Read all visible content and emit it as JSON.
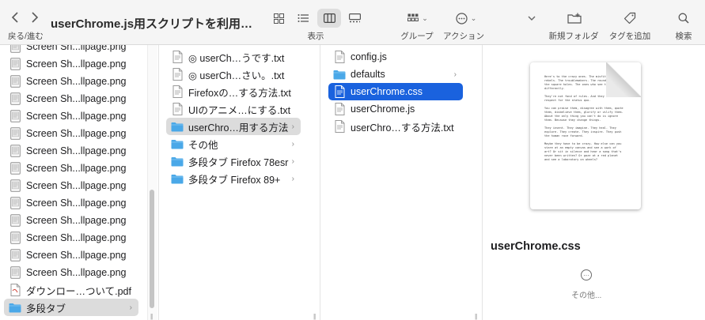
{
  "toolbar": {
    "nav_label": "戻る/進む",
    "title": "userChrome.js用スクリプトを利用…",
    "view_label": "表示",
    "group_label": "グループ",
    "action_label": "アクション",
    "new_folder_label": "新規フォルダ",
    "tag_label": "タグを追加",
    "search_label": "検索"
  },
  "column1": {
    "items": [
      {
        "label": "Screen Sh...llpage.png",
        "icon": "image-file-icon"
      },
      {
        "label": "Screen Sh...llpage.png",
        "icon": "image-file-icon"
      },
      {
        "label": "Screen Sh...llpage.png",
        "icon": "image-file-icon"
      },
      {
        "label": "Screen Sh...llpage.png",
        "icon": "image-file-icon"
      },
      {
        "label": "Screen Sh...llpage.png",
        "icon": "image-file-icon"
      },
      {
        "label": "Screen Sh...llpage.png",
        "icon": "image-file-icon"
      },
      {
        "label": "Screen Sh...llpage.png",
        "icon": "image-file-icon"
      },
      {
        "label": "Screen Sh...llpage.png",
        "icon": "image-file-icon"
      },
      {
        "label": "Screen Sh...llpage.png",
        "icon": "image-file-icon"
      },
      {
        "label": "Screen Sh...llpage.png",
        "icon": "image-file-icon"
      },
      {
        "label": "Screen Sh...llpage.png",
        "icon": "image-file-icon"
      },
      {
        "label": "Screen Sh...llpage.png",
        "icon": "image-file-icon"
      },
      {
        "label": "Screen Sh...llpage.png",
        "icon": "image-file-icon"
      },
      {
        "label": "Screen Sh...llpage.png",
        "icon": "image-file-icon"
      },
      {
        "label": "ダウンロー…ついて.pdf",
        "icon": "pdf-file-icon"
      },
      {
        "label": "多段タブ",
        "icon": "folder-icon"
      }
    ]
  },
  "column2": {
    "items": [
      {
        "label": "◎ userCh…うです.txt",
        "icon": "text-file-icon"
      },
      {
        "label": "◎ userCh…さい。.txt",
        "icon": "text-file-icon"
      },
      {
        "label": "Firefoxの…する方法.txt",
        "icon": "text-file-icon"
      },
      {
        "label": "UIのアニメ…にする.txt",
        "icon": "text-file-icon"
      },
      {
        "label": "userChro…用する方法",
        "icon": "folder-icon"
      },
      {
        "label": "その他",
        "icon": "folder-icon"
      },
      {
        "label": "多段タブ Firefox 78esr",
        "icon": "folder-icon"
      },
      {
        "label": "多段タブ Firefox 89+",
        "icon": "folder-icon"
      }
    ]
  },
  "column3": {
    "items": [
      {
        "label": "config.js",
        "icon": "text-file-icon"
      },
      {
        "label": "defaults",
        "icon": "folder-icon"
      },
      {
        "label": "userChrome.css",
        "icon": "text-file-icon"
      },
      {
        "label": "userChrome.js",
        "icon": "text-file-icon"
      },
      {
        "label": "userChro…する方法.txt",
        "icon": "text-file-icon"
      }
    ]
  },
  "preview": {
    "doc_text": "Here's to the crazy ones. The misfits. The rebels. The troublemakers. The round pegs in the square holes. The ones who see things differently.\n\nThey're not fond of rules. And they have no respect for the status quo.\n\nYou can praise them, disagree with them, quote them, disbelieve them, glorify or vilify them. About the only thing you can't do is ignore them. Because they change things.\n\nThey invent. They imagine. They heal. They explore. They create. They inspire. They push the human race forward.\n\nMaybe they have to be crazy. How else can you stare at an empty canvas and see a work of art? Or sit in silence and hear a song that's never been written? Or gaze at a red planet and see a laboratory on wheels?",
    "filename": "userChrome.css",
    "more_label": "その他..."
  },
  "colors": {
    "selection_blue": "#1a62de",
    "folder_blue": "#4aa8e8",
    "toolbar_bg": "#f5f5f5"
  }
}
